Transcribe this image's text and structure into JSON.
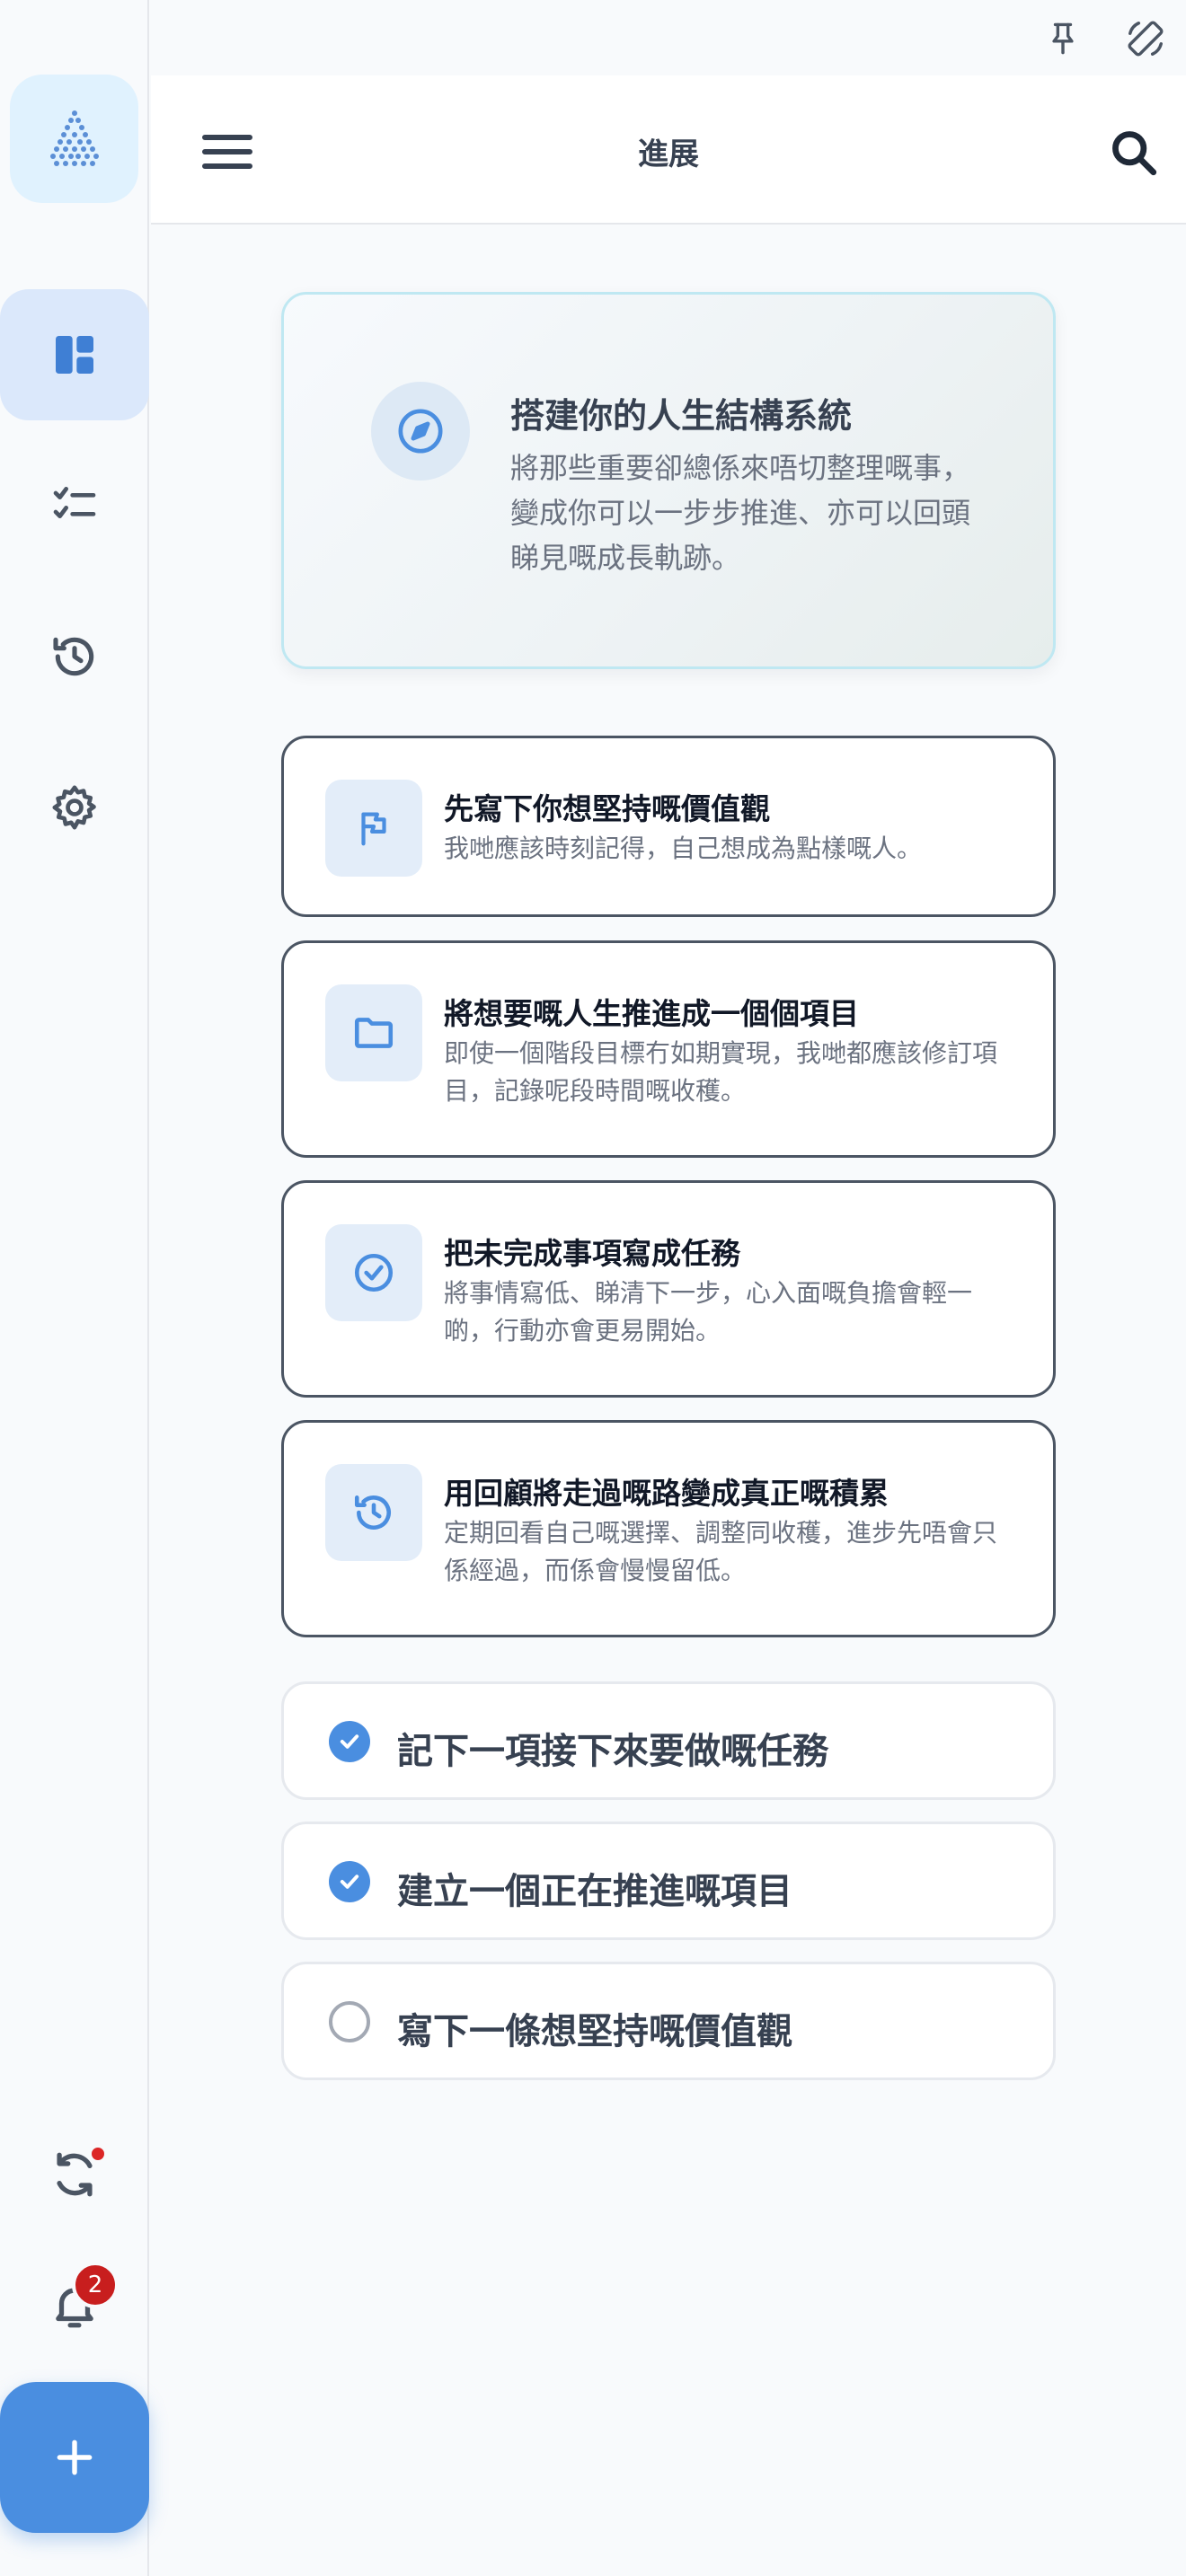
{
  "appbar": {
    "title": "進展"
  },
  "hero": {
    "title": "搭建你的人生結構系統",
    "body": "將那些重要卻總係來唔切整理嘅事，變成你可以一步步推進、亦可以回頭睇見嘅成長軌跡。"
  },
  "steps": [
    {
      "title": "先寫下你想堅持嘅價值觀",
      "body": "我哋應該時刻記得，自己想成為點樣嘅人。",
      "icon": "flag-icon"
    },
    {
      "title": "將想要嘅人生推進成一個個項目",
      "body": "即使一個階段目標冇如期實現，我哋都應該修訂項目，記錄呢段時間嘅收穫。",
      "icon": "folder-icon"
    },
    {
      "title": "把未完成事項寫成任務",
      "body": "將事情寫低、睇清下一步，心入面嘅負擔會輕一啲，行動亦會更易開始。",
      "icon": "check-circle-icon"
    },
    {
      "title": "用回顧將走過嘅路變成真正嘅積累",
      "body": "定期回看自己嘅選擇、調整同收穫，進步先唔會只係經過，而係會慢慢留低。",
      "icon": "history-icon"
    }
  ],
  "checklist": [
    {
      "label": "記下一項接下來要做嘅任務",
      "done": true
    },
    {
      "label": "建立一個正在推進嘅項目",
      "done": true
    },
    {
      "label": "寫下一條想堅持嘅價值觀",
      "done": false
    }
  ],
  "rail": {
    "items": [
      "dashboard-icon",
      "tasks-icon",
      "history-icon",
      "settings-icon"
    ],
    "notification_count": "2",
    "sync_has_update": true
  },
  "colors": {
    "accent": "#4a8ee0",
    "badge": "#c81e1e"
  }
}
